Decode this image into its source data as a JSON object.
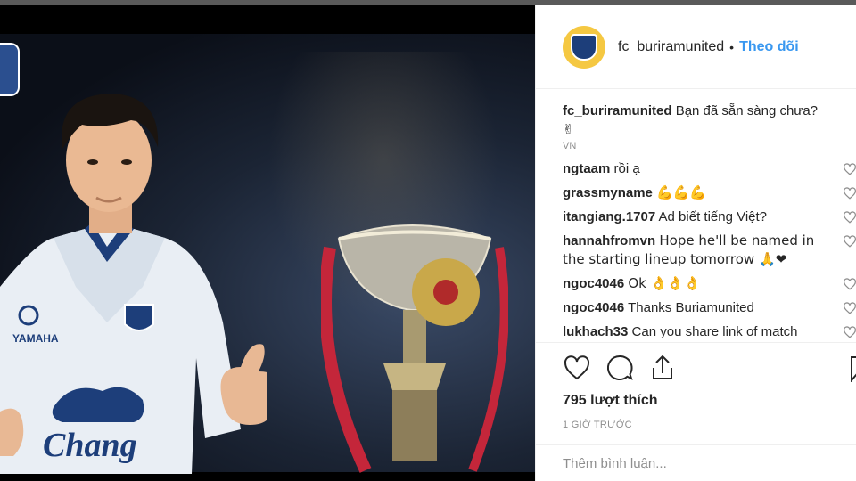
{
  "post": {
    "username": "fc_buriramunited",
    "follow_label": "Theo dõi",
    "caption_user": "fc_buriramunited",
    "caption_text": "Bạn đã sẵn sàng chưa? ✌",
    "caption_meta": "VN"
  },
  "comments": [
    {
      "user": "ngtaam",
      "text": "rồi ạ"
    },
    {
      "user": "grassmyname",
      "text": "💪💪💪"
    },
    {
      "user": "itangiang.1707",
      "text": "Ad biết tiếng Việt?"
    },
    {
      "user": "hannahfromvn",
      "text": "Hope he'll be named in the starting lineup tomorrow 🙏❤"
    },
    {
      "user": "ngoc4046",
      "text": "Ok 👌👌👌"
    },
    {
      "user": "ngoc4046",
      "text": "Thanks Buriamunited"
    },
    {
      "user": "lukhach33",
      "text": "Can you share link of match"
    }
  ],
  "likes_label": "795 lượt thích",
  "time_ago": "1 GIỜ TRƯỚC",
  "add_comment_placeholder": "Thêm bình luận...",
  "photo": {
    "jersey_sponsor": "Chang",
    "jersey_brand": "YAMAHA"
  },
  "icons": [
    "heart-icon",
    "comment-icon",
    "share-icon",
    "bookmark-icon"
  ],
  "colors": {
    "follow": "#3897f0",
    "avatar_bg": "#f5c842",
    "club_blue": "#1d3e7a"
  }
}
